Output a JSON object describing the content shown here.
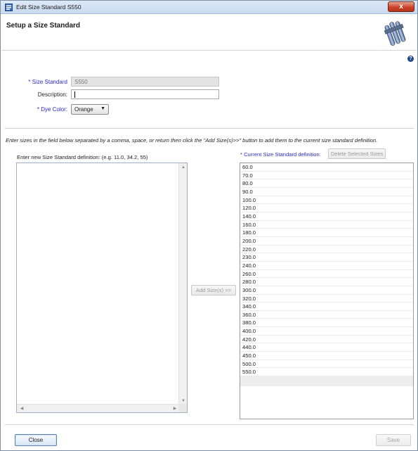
{
  "window": {
    "title": "Edit Size Standard S550",
    "close_glyph": "x"
  },
  "header": {
    "heading": "Setup a Size Standard",
    "logo_icon": "test-tubes-logo"
  },
  "help": {
    "glyph": "?"
  },
  "form": {
    "size_standard": {
      "label": "* Size Standard",
      "value": "S550"
    },
    "description": {
      "label": "Description:",
      "value": ""
    },
    "dye_color": {
      "label": "* Dye Color:",
      "selected": "Orange"
    }
  },
  "instructions": "Enter sizes in the field below separated by a comma, space, or return then click the \"Add Size(s)>>\" button to add them to the current size standard definition.",
  "new_definition": {
    "label": "Enter new Size Standard definition: (e.g. 11.0, 34.2, 55)",
    "value": ""
  },
  "add_button": {
    "label": "Add Size(s)  >>"
  },
  "current_definition": {
    "label": "* Current Size Standard definition:",
    "delete_label": "Delete Selected Sizes",
    "sizes": [
      "60.0",
      "70.0",
      "80.0",
      "90.0",
      "100.0",
      "120.0",
      "140.0",
      "160.0",
      "180.0",
      "200.0",
      "220.0",
      "230.0",
      "240.0",
      "260.0",
      "280.0",
      "300.0",
      "320.0",
      "340.0",
      "360.0",
      "380.0",
      "400.0",
      "420.0",
      "440.0",
      "450.0",
      "500.0",
      "550.0"
    ]
  },
  "footer": {
    "close_label": "Close",
    "save_label": "Save"
  },
  "colors": {
    "required_label": "#2a2ad0",
    "titlebar": "#c9daee",
    "close_button": "#c9442a"
  }
}
